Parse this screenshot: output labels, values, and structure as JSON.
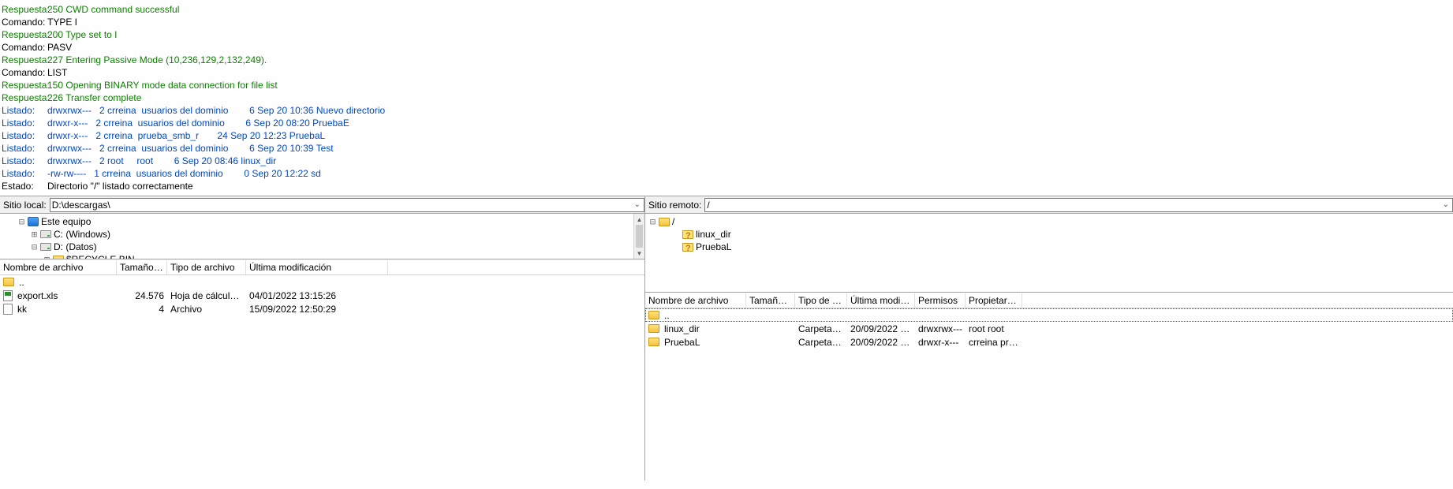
{
  "log": [
    {
      "label": "Respuesta:",
      "msg": "250 CWD command successful",
      "cls": "green"
    },
    {
      "label": "Comando:",
      "msg": "TYPE I",
      "cls": "black"
    },
    {
      "label": "Respuesta:",
      "msg": "200 Type set to I",
      "cls": "green"
    },
    {
      "label": "Comando:",
      "msg": "PASV",
      "cls": "black"
    },
    {
      "label": "Respuesta:",
      "msg": "227 Entering Passive Mode (10,236,129,2,132,249).",
      "cls": "green"
    },
    {
      "label": "Comando:",
      "msg": "LIST",
      "cls": "black"
    },
    {
      "label": "Respuesta:",
      "msg": "150 Opening BINARY mode data connection for file list",
      "cls": "green"
    },
    {
      "label": "Respuesta:",
      "msg": "226 Transfer complete",
      "cls": "green"
    },
    {
      "label": "Listado:",
      "msg": "drwxrwx---   2 crreina  usuarios del dominio        6 Sep 20 10:36 Nuevo directorio",
      "cls": "blue"
    },
    {
      "label": "Listado:",
      "msg": "drwxr-x---   2 crreina  usuarios del dominio        6 Sep 20 08:20 PruebaE",
      "cls": "blue"
    },
    {
      "label": "Listado:",
      "msg": "drwxr-x---   2 crreina  prueba_smb_r       24 Sep 20 12:23 PruebaL",
      "cls": "blue"
    },
    {
      "label": "Listado:",
      "msg": "drwxrwx---   2 crreina  usuarios del dominio        6 Sep 20 10:39 Test",
      "cls": "blue"
    },
    {
      "label": "Listado:",
      "msg": "drwxrwx---   2 root     root        6 Sep 20 08:46 linux_dir",
      "cls": "blue"
    },
    {
      "label": "Listado:",
      "msg": "-rw-rw----   1 crreina  usuarios del dominio        0 Sep 20 12:22 sd",
      "cls": "blue"
    },
    {
      "label": "Estado:",
      "msg": "Directorio \"/\" listado correctamente",
      "cls": "black"
    }
  ],
  "local": {
    "label": "Sitio local:",
    "path": "D:\\descargas\\",
    "tree": [
      {
        "name": "Este equipo",
        "icon": "computer",
        "indent": 22,
        "toggle": "-"
      },
      {
        "name": "C: (Windows)",
        "icon": "drive",
        "indent": 38,
        "toggle": "+"
      },
      {
        "name": "D: (Datos)",
        "icon": "drive",
        "indent": 38,
        "toggle": "-"
      },
      {
        "name": "$RECYCLE.BIN",
        "icon": "folder",
        "indent": 54,
        "toggle": "+"
      }
    ],
    "cols": {
      "name": "Nombre de archivo",
      "size": "Tamaño de...",
      "type": "Tipo de archivo",
      "mod": "Última modificación"
    },
    "files": [
      {
        "name": "..",
        "icon": "folder",
        "size": "",
        "type": "",
        "mod": ""
      },
      {
        "name": "export.xls",
        "icon": "xls",
        "size": "24.576",
        "type": "Hoja de cálculo de...",
        "mod": "04/01/2022 13:15:26"
      },
      {
        "name": "kk",
        "icon": "file",
        "size": "4",
        "type": "Archivo",
        "mod": "15/09/2022 12:50:29"
      }
    ]
  },
  "remote": {
    "label": "Sitio remoto:",
    "path": "/",
    "tree": [
      {
        "name": "/",
        "icon": "folder",
        "indent": 4,
        "toggle": "-"
      },
      {
        "name": "linux_dir",
        "icon": "folder-q",
        "indent": 34,
        "toggle": ""
      },
      {
        "name": "PruebaL",
        "icon": "folder-q",
        "indent": 34,
        "toggle": ""
      }
    ],
    "cols": {
      "name": "Nombre de archivo",
      "size": "Tamaño d...",
      "type": "Tipo de arc...",
      "mod": "Última modific...",
      "perm": "Permisos",
      "own": "Propietario/..."
    },
    "files": [
      {
        "name": "..",
        "icon": "folder",
        "size": "",
        "type": "",
        "mod": "",
        "perm": "",
        "own": "",
        "sel": true
      },
      {
        "name": "linux_dir",
        "icon": "folder",
        "size": "",
        "type": "Carpeta de...",
        "mod": "20/09/2022 10:...",
        "perm": "drwxrwx---",
        "own": "root root"
      },
      {
        "name": "PruebaL",
        "icon": "folder",
        "size": "",
        "type": "Carpeta de...",
        "mod": "20/09/2022 14:...",
        "perm": "drwxr-x---",
        "own": "crreina prue..."
      }
    ]
  }
}
